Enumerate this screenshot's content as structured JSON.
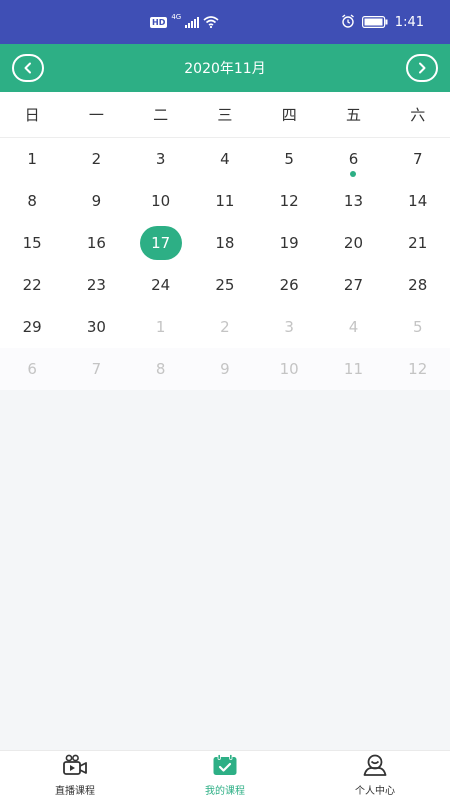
{
  "status_bar": {
    "badge": "HD",
    "network": "4G",
    "time": "1:41",
    "icons": [
      "signal-icon",
      "wifi-icon",
      "alarm-icon",
      "battery-icon"
    ]
  },
  "header": {
    "title": "2020年11月",
    "prev_icon": "chevron-left-icon",
    "next_icon": "chevron-right-icon"
  },
  "calendar": {
    "weekdays": [
      "日",
      "一",
      "二",
      "三",
      "四",
      "五",
      "六"
    ],
    "weeks": [
      [
        "1",
        "2",
        "3",
        "4",
        "5",
        "6",
        "7"
      ],
      [
        "8",
        "9",
        "10",
        "11",
        "12",
        "13",
        "14"
      ],
      [
        "15",
        "16",
        "17",
        "18",
        "19",
        "20",
        "21"
      ],
      [
        "22",
        "23",
        "24",
        "25",
        "26",
        "27",
        "28"
      ],
      [
        "29",
        "30",
        "1",
        "2",
        "3",
        "4",
        "5"
      ],
      [
        "6",
        "7",
        "8",
        "9",
        "10",
        "11",
        "12"
      ]
    ],
    "selected_day": "17",
    "event_days": [
      "6"
    ]
  },
  "tabbar": {
    "tabs": [
      {
        "label": "直播课程",
        "icon": "video-camera-icon"
      },
      {
        "label": "我的课程",
        "icon": "calendar-check-icon"
      },
      {
        "label": "个人中心",
        "icon": "user-icon"
      }
    ],
    "active_index": 1
  },
  "colors": {
    "status_bar": "#3f4fb5",
    "accent": "#2daf85",
    "text": "#333333",
    "muted": "#c4c4c4"
  }
}
